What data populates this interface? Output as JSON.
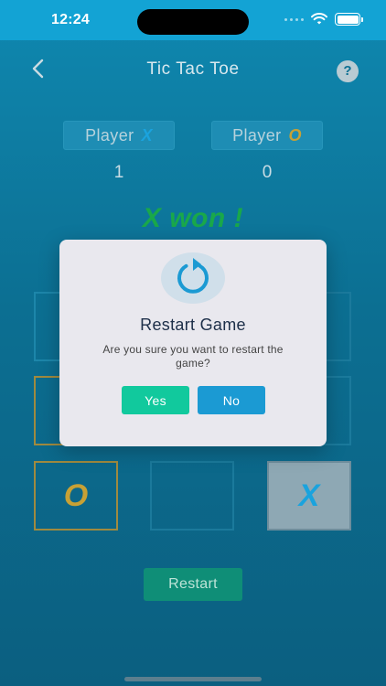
{
  "status_bar": {
    "time": "12:24"
  },
  "header": {
    "title": "Tic Tac Toe",
    "help_symbol": "?"
  },
  "players": [
    {
      "label": "Player",
      "mark": "X",
      "score": "1"
    },
    {
      "label": "Player",
      "mark": "O",
      "score": "0"
    }
  ],
  "result": "X won !",
  "board": {
    "cells": [
      "",
      "",
      "",
      "",
      "",
      "",
      "O",
      "",
      "X"
    ]
  },
  "restart_button": "Restart",
  "dialog": {
    "title": "Restart Game",
    "message": "Are you sure you want to restart the game?",
    "yes": "Yes",
    "no": "No"
  },
  "icons": {
    "back": "back-arrow-icon",
    "help": "question-icon",
    "restart": "restart-icon",
    "wifi": "wifi-icon",
    "battery": "battery-icon"
  },
  "colors": {
    "background": "#0e7fa6",
    "status_bar": "#13a3d4",
    "x_mark": "#1aa3de",
    "o_mark": "#c7a135",
    "win_text": "#19a84a",
    "yes_button": "#11c99d",
    "no_button": "#1b9ad3",
    "dialog_bg": "#e9e8ee"
  }
}
